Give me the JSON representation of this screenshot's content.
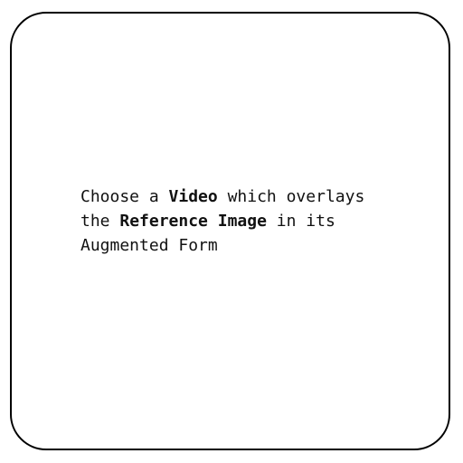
{
  "instruction": {
    "line1_pre": "Choose a ",
    "line1_bold": "Video",
    "line1_post": " which overlays",
    "line2_pre": "the ",
    "line2_bold": "Reference Image",
    "line2_post": " in its",
    "line3": "Augmented Form"
  }
}
